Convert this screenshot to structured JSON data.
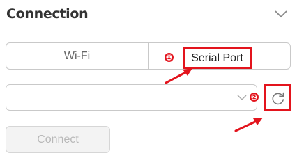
{
  "panel": {
    "title": "Connection",
    "collapse_icon": "chevron-down-icon"
  },
  "connection_type": {
    "options": [
      {
        "label": "Wi-Fi",
        "selected": false
      },
      {
        "label": "Serial Port",
        "selected": true
      }
    ]
  },
  "port_select": {
    "value": "",
    "arrow_icon": "chevron-down-icon"
  },
  "refresh": {
    "icon": "refresh-icon"
  },
  "connect_button": {
    "label": "Connect",
    "disabled": true
  },
  "annotations": {
    "marker_1": "①",
    "marker_2": "②",
    "color": "#e3141d"
  },
  "colors": {
    "title": "#333333",
    "border": "#c9c9c9",
    "annotation_red": "#e3141d",
    "disabled_bg": "#f3f3f3",
    "disabled_text": "#b8b8b8"
  }
}
